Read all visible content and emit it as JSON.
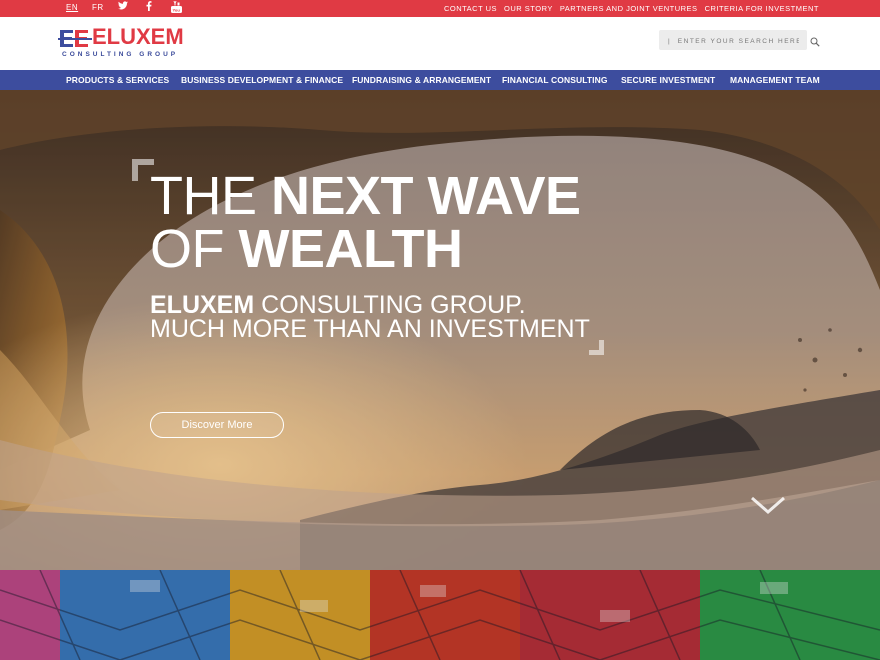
{
  "topbar": {
    "lang_en": "EN",
    "lang_fr": "FR",
    "social": [
      "twitter-icon",
      "facebook-icon",
      "youtube-icon"
    ],
    "links": [
      "CONTACT US",
      "OUR STORY",
      "PARTNERS AND JOINT VENTURES",
      "CRITERIA FOR INVESTMENT"
    ]
  },
  "brand": {
    "name": "ELUXEM",
    "tagline": "CONSULTING GROUP",
    "color_red": "#e03a44",
    "color_blue": "#3d4d9e"
  },
  "search": {
    "placeholder": "|  ENTER YOUR SEARCH HERE:",
    "icon": "search-icon"
  },
  "nav": {
    "items": [
      "PRODUCTS & SERVICES",
      "BUSINESS DEVELOPMENT & FINANCE",
      "FUNDRAISING & ARRANGEMENT",
      "FINANCIAL CONSULTING",
      "SECURE INVESTMENT",
      "MANAGEMENT TEAM"
    ]
  },
  "hero": {
    "line1_thin": "THE ",
    "line1_bold": "NEXT WAVE",
    "line2_thin": "OF ",
    "line2_bold": "WEALTH",
    "sub1_bold": "ELUXEM",
    "sub1_rest": " CONSULTING GROUP.",
    "sub2": "MUCH MORE THAN AN INVESTMENT",
    "cta": "Discover More",
    "scroll_icon": "chevron-down-icon"
  }
}
